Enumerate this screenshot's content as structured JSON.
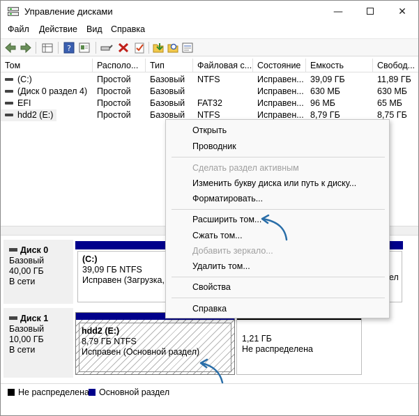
{
  "window": {
    "title": "Управление дисками"
  },
  "menu": [
    "Файл",
    "Действие",
    "Вид",
    "Справка"
  ],
  "toolbar_icons": [
    "back-icon",
    "forward-icon",
    "list-view-icon",
    "help-icon",
    "properties-icon",
    "connect-icon",
    "delete-icon",
    "check-icon",
    "new-volume-icon",
    "search-icon",
    "details-icon"
  ],
  "table": {
    "columns": [
      "Том",
      "Располо...",
      "Тип",
      "Файловая с...",
      "Состояние",
      "Емкость",
      "Свобод..."
    ],
    "rows": [
      {
        "volume": "(C:)",
        "layout": "Простой",
        "type": "Базовый",
        "fs": "NTFS",
        "status": "Исправен...",
        "capacity": "39,09 ГБ",
        "free": "11,89 ГБ"
      },
      {
        "volume": "(Диск 0 раздел 4)",
        "layout": "Простой",
        "type": "Базовый",
        "fs": "",
        "status": "Исправен...",
        "capacity": "630 МБ",
        "free": "630 МБ"
      },
      {
        "volume": "EFI",
        "layout": "Простой",
        "type": "Базовый",
        "fs": "FAT32",
        "status": "Исправен...",
        "capacity": "96 МБ",
        "free": "65 МБ"
      },
      {
        "volume": "hdd2 (E:)",
        "layout": "Простой",
        "type": "Базовый",
        "fs": "NTFS",
        "status": "Исправен...",
        "capacity": "8,79 ГБ",
        "free": "8,75 ГБ"
      }
    ]
  },
  "disks": [
    {
      "name": "Диск 0",
      "type": "Базовый",
      "size": "40,00 ГБ",
      "state": "В сети",
      "partitions": [
        {
          "name": "(C:)",
          "size": "39,09 ГБ NTFS",
          "status": "Исправен (Загрузка, Ф"
        },
        {
          "name": "",
          "size": "",
          "status": "ел"
        }
      ]
    },
    {
      "name": "Диск 1",
      "type": "Базовый",
      "size": "10,00 ГБ",
      "state": "В сети",
      "partitions": [
        {
          "name": "hdd2  (E:)",
          "size": "8,79 ГБ NTFS",
          "status": "Исправен (Основной раздел)"
        },
        {
          "name": "",
          "size": "1,21 ГБ",
          "status": "Не распределена"
        }
      ]
    }
  ],
  "legend": [
    {
      "label": "Не распределена",
      "color": "#000000"
    },
    {
      "label": "Основной раздел",
      "color": "#00008b"
    }
  ],
  "context_menu": {
    "items": [
      {
        "label": "Открыть",
        "enabled": true
      },
      {
        "label": "Проводник",
        "enabled": true
      },
      {
        "label": "Сделать раздел активным",
        "enabled": false
      },
      {
        "label": "Изменить букву диска или путь к диску...",
        "enabled": true
      },
      {
        "label": "Форматировать...",
        "enabled": true
      },
      {
        "label": "Расширить том...",
        "enabled": true
      },
      {
        "label": "Сжать том...",
        "enabled": true
      },
      {
        "label": "Добавить зеркало...",
        "enabled": false
      },
      {
        "label": "Удалить том...",
        "enabled": true
      },
      {
        "label": "Свойства",
        "enabled": true
      },
      {
        "label": "Справка",
        "enabled": true
      }
    ]
  },
  "colors": {
    "primary_partition": "#00008b",
    "unallocated": "#000000",
    "arrow": "#2a6ea8"
  }
}
